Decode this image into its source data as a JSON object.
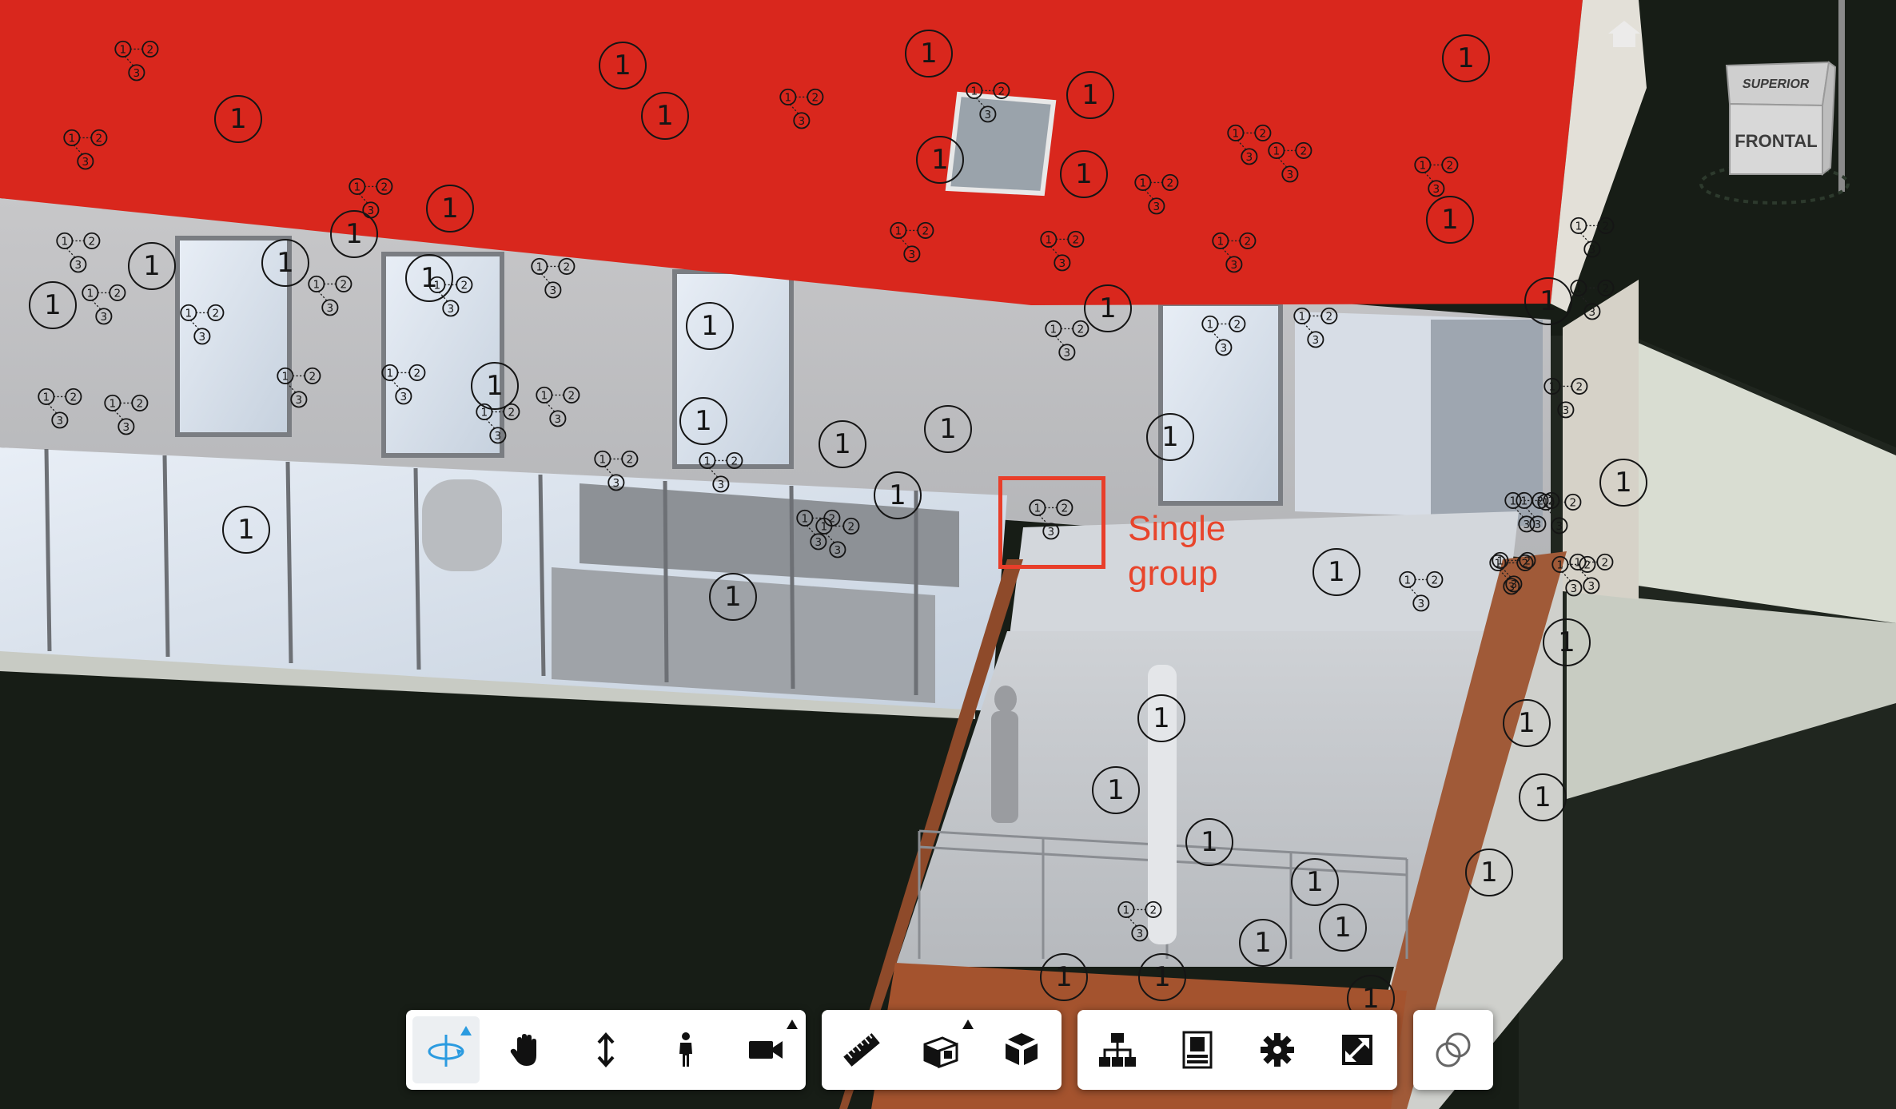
{
  "annotation": {
    "line1": "Single",
    "line2": "group",
    "color": "#e8452c"
  },
  "viewcube": {
    "top_face": "SUPERIOR",
    "front_face": "FRONTAL"
  },
  "toolbar": {
    "navigation": [
      {
        "name": "orbit-tool",
        "icon": "orbit-icon",
        "active": true,
        "flyout": true
      },
      {
        "name": "pan-tool",
        "icon": "hand-icon"
      },
      {
        "name": "zoom-tool",
        "icon": "vertical-arrows-icon"
      },
      {
        "name": "first-person-tool",
        "icon": "person-icon"
      },
      {
        "name": "camera-tool",
        "icon": "camera-icon",
        "flyout": true
      }
    ],
    "analysis": [
      {
        "name": "measure-tool",
        "icon": "ruler-icon"
      },
      {
        "name": "section-tool",
        "icon": "section-box-icon",
        "flyout": true
      },
      {
        "name": "explode-tool",
        "icon": "explode-cube-icon"
      }
    ],
    "settings": [
      {
        "name": "model-browser-tool",
        "icon": "hierarchy-icon"
      },
      {
        "name": "properties-tool",
        "icon": "properties-panel-icon"
      },
      {
        "name": "settings-tool",
        "icon": "gear-icon"
      },
      {
        "name": "fullscreen-tool",
        "icon": "fullscreen-icon"
      }
    ],
    "extra": [
      {
        "name": "markup-tool",
        "icon": "overlapping-circles-icon"
      }
    ]
  },
  "markers": {
    "single_label": "1",
    "group_labels": [
      "1",
      "2",
      "3"
    ]
  }
}
